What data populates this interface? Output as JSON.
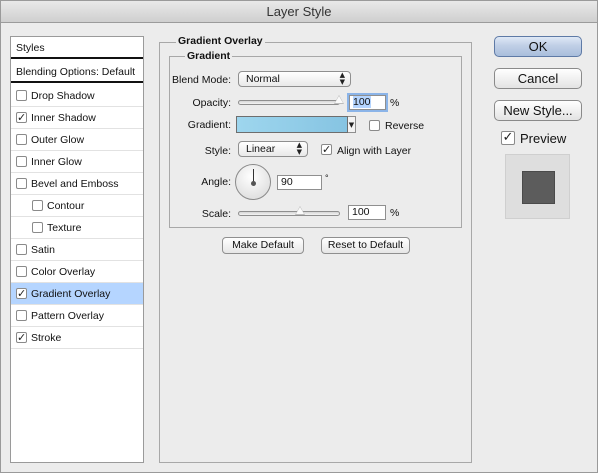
{
  "window": {
    "title": "Layer Style"
  },
  "sidebar": {
    "header": "Styles",
    "blending": "Blending Options: Default",
    "items": [
      {
        "label": "Drop Shadow",
        "checked": false
      },
      {
        "label": "Inner Shadow",
        "checked": true
      },
      {
        "label": "Outer Glow",
        "checked": false
      },
      {
        "label": "Inner Glow",
        "checked": false
      },
      {
        "label": "Bevel and Emboss",
        "checked": false
      },
      {
        "label": "Contour",
        "checked": false
      },
      {
        "label": "Texture",
        "checked": false
      },
      {
        "label": "Satin",
        "checked": false
      },
      {
        "label": "Color Overlay",
        "checked": false
      },
      {
        "label": "Gradient Overlay",
        "checked": true,
        "selected": true
      },
      {
        "label": "Pattern Overlay",
        "checked": false
      },
      {
        "label": "Stroke",
        "checked": true
      }
    ]
  },
  "panel": {
    "outer_title": "Gradient Overlay",
    "inner_title": "Gradient",
    "blend_mode": {
      "label": "Blend Mode:",
      "value": "Normal"
    },
    "opacity": {
      "label": "Opacity:",
      "value": "100",
      "unit": "%",
      "level": 1.0
    },
    "gradient": {
      "label": "Gradient:",
      "start_color": "#9ed6ee",
      "end_color": "#86c4e2"
    },
    "reverse": {
      "label": "Reverse",
      "checked": false
    },
    "style": {
      "label": "Style:",
      "value": "Linear"
    },
    "align_with_layer": {
      "label": "Align with Layer",
      "checked": true
    },
    "angle": {
      "label": "Angle:",
      "value": "90",
      "unit": "°"
    },
    "scale": {
      "label": "Scale:",
      "value": "100",
      "unit": "%",
      "level": 0.5
    },
    "make_default": "Make Default",
    "reset_default": "Reset to Default"
  },
  "buttons": {
    "ok": "OK",
    "cancel": "Cancel",
    "new_style": "New Style..."
  },
  "preview": {
    "label": "Preview",
    "checked": true,
    "swatch_color": "#5c5c5c"
  }
}
